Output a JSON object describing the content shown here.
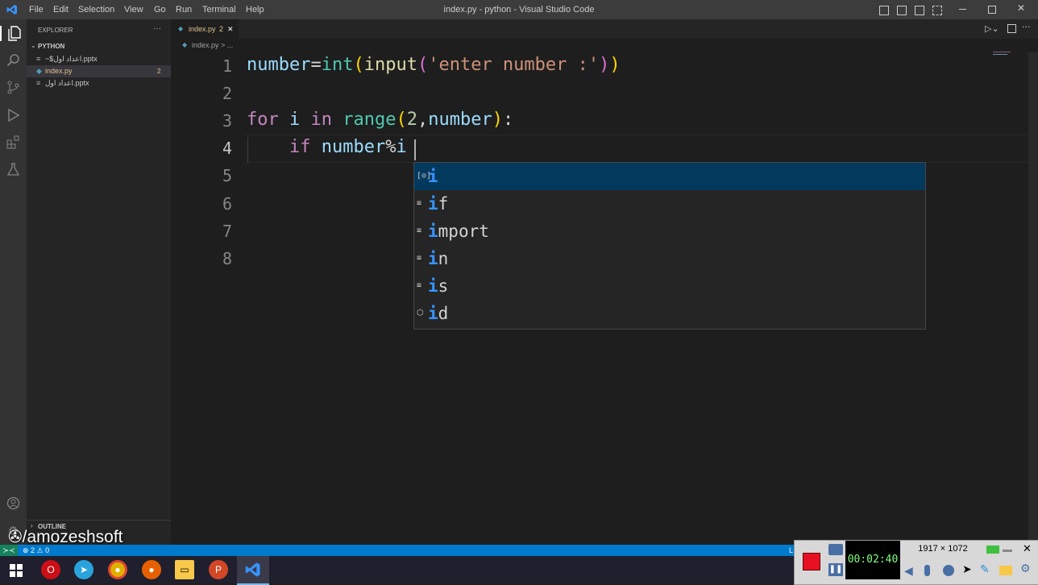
{
  "titlebar": {
    "menu": [
      "File",
      "Edit",
      "Selection",
      "View",
      "Go",
      "Run",
      "Terminal",
      "Help"
    ],
    "title": "index.py - python - Visual Studio Code"
  },
  "sidebar": {
    "header": "EXPLORER",
    "more": "···",
    "folder": "PYTHON",
    "files": [
      {
        "name": "~$اعداد اول.pptx",
        "badge": ""
      },
      {
        "name": "index.py",
        "badge": "2"
      },
      {
        "name": "اعداد اول.pptx",
        "badge": ""
      }
    ],
    "outline": "OUTLINE"
  },
  "tab": {
    "label": "index.py",
    "badge": "2",
    "close": "✕"
  },
  "breadcrumb": "index.py > ...",
  "editor": {
    "line_numbers": [
      "1",
      "2",
      "3",
      "4",
      "5",
      "6",
      "7",
      "8"
    ],
    "lines": [
      [
        {
          "t": "number",
          "c": "#9cdcfe"
        },
        {
          "t": "=",
          "c": "#d4d4d4"
        },
        {
          "t": "int",
          "c": "#4ec9b0"
        },
        {
          "t": "(",
          "c": "#ffd700"
        },
        {
          "t": "input",
          "c": "#dcdcaa"
        },
        {
          "t": "(",
          "c": "#da70d6"
        },
        {
          "t": "'enter number :'",
          "c": "#ce9178"
        },
        {
          "t": ")",
          "c": "#da70d6"
        },
        {
          "t": ")",
          "c": "#ffd700"
        }
      ],
      [],
      [
        {
          "t": "for",
          "c": "#c586c0"
        },
        {
          "t": " i ",
          "c": "#9cdcfe"
        },
        {
          "t": "in",
          "c": "#c586c0"
        },
        {
          "t": " ",
          "c": "#d4d4d4"
        },
        {
          "t": "range",
          "c": "#4ec9b0"
        },
        {
          "t": "(",
          "c": "#ffd700"
        },
        {
          "t": "2",
          "c": "#b5cea8"
        },
        {
          "t": ",",
          "c": "#d4d4d4"
        },
        {
          "t": "number",
          "c": "#9cdcfe"
        },
        {
          "t": ")",
          "c": "#ffd700"
        },
        {
          "t": ":",
          "c": "#d4d4d4"
        }
      ],
      [
        {
          "t": "    if",
          "c": "#c586c0"
        },
        {
          "t": " number",
          "c": "#9cdcfe"
        },
        {
          "t": "%",
          "c": "#d4d4d4"
        },
        {
          "t": "i",
          "c": "#9cdcfe"
        }
      ]
    ]
  },
  "suggest": [
    {
      "kind": "[⊙]",
      "match": "i",
      "rest": ""
    },
    {
      "kind": "≡",
      "match": "i",
      "rest": "f"
    },
    {
      "kind": "≡",
      "match": "i",
      "rest": "mport"
    },
    {
      "kind": "≡",
      "match": "i",
      "rest": "n"
    },
    {
      "kind": "≡",
      "match": "i",
      "rest": "s"
    },
    {
      "kind": "⬡",
      "match": "i",
      "rest": "d"
    }
  ],
  "status": {
    "errors": "⊗ 2 ⚠ 0",
    "right": "L"
  },
  "watermark": "/amozeshsoft",
  "recorder": {
    "time": "00:02:40",
    "size": "1917 × 1072"
  },
  "colors": {
    "accent": "#007acc",
    "selection": "#04395e",
    "record": "#e81123"
  }
}
